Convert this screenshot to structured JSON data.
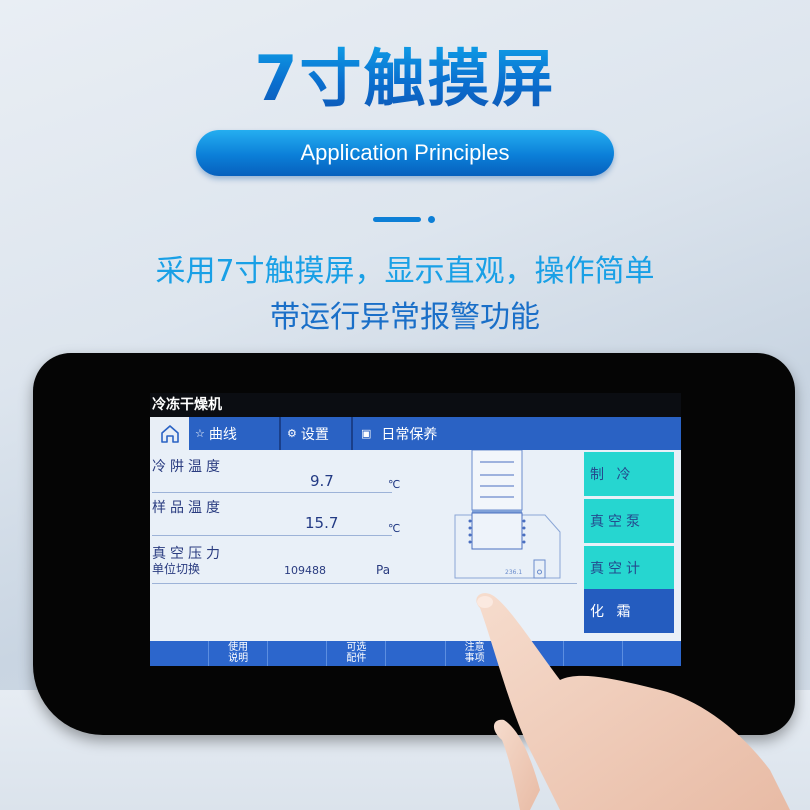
{
  "headline": "7寸触摸屏",
  "pill_label": "Application Principles",
  "subtitle_line1": "采用7寸触摸屏，显示直观，操作简单",
  "subtitle_line2": "带运行异常报警功能",
  "colors": {
    "accent_blue": "#0a76d6",
    "pill_blue": "#0b7fd8",
    "tab_blue": "#2a62c4",
    "cyan_button": "#26d6d0",
    "dark_blue_button": "#245cbf"
  },
  "screen": {
    "app_title": "冷冻干燥机",
    "tabs": [
      {
        "icon": "home-icon",
        "label": ""
      },
      {
        "icon": "star-icon",
        "label": "曲线"
      },
      {
        "icon": "gear-icon",
        "label": "设置"
      },
      {
        "icon": "document-icon",
        "label": "日常保养"
      }
    ],
    "readings": [
      {
        "label": "冷阱温度",
        "value": "9.7",
        "unit": "℃"
      },
      {
        "label": "样品温度",
        "value": "15.7",
        "unit": "℃"
      },
      {
        "label": "真空压力",
        "sublabel": "单位切换",
        "value": "109488",
        "unit": "Pa"
      }
    ],
    "diagram_value": "236.1",
    "right_buttons": [
      {
        "label": "制 冷",
        "state": "active"
      },
      {
        "label": "真空泵",
        "state": "active"
      },
      {
        "label": "真空计",
        "state": "active"
      },
      {
        "label": "化 霜",
        "state": "inactive"
      }
    ],
    "bottom_bar": [
      "",
      "使用\n说明",
      "",
      "可选\n配件",
      "",
      "注意\n事项",
      "",
      "",
      ""
    ]
  }
}
